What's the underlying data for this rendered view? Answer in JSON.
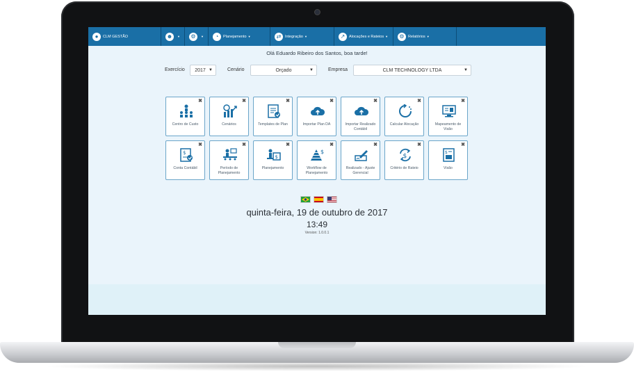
{
  "navbar": {
    "brand": "CLM GESTÃO",
    "menus": [
      "Planejamento",
      "Integração",
      "Alocações e Rateios",
      "Relatórios"
    ]
  },
  "greeting": "Olá Eduardo Ribeiro dos Santos, boa tarde!",
  "filters": {
    "exercicio_label": "Exercício",
    "exercicio_value": "2017",
    "cenario_label": "Cenário",
    "cenario_value": "Orçado",
    "empresa_label": "Empresa",
    "empresa_value": "CLM TECHNOLOGY LTDA"
  },
  "tiles": [
    {
      "label": "Centro de Custo",
      "icon": "org-chart-icon"
    },
    {
      "label": "Cenários",
      "icon": "money-chart-icon"
    },
    {
      "label": "Templates de Plan",
      "icon": "template-icon"
    },
    {
      "label": "Importar Plan DA",
      "icon": "cloud-upload-icon"
    },
    {
      "label": "Importar Realizado Contábil",
      "icon": "cloud-upload-icon"
    },
    {
      "label": "Calcular Alocação",
      "icon": "refresh-icon"
    },
    {
      "label": "Mapeamento de Visão",
      "icon": "monitor-icon"
    },
    {
      "label": "Conta Contábil",
      "icon": "document-money-icon"
    },
    {
      "label": "Período de Planejamento",
      "icon": "meeting-icon"
    },
    {
      "label": "Planejamento",
      "icon": "desk-icon"
    },
    {
      "label": "Workflow de Planejamento",
      "icon": "pyramid-icon"
    },
    {
      "label": "Realizado - Ajuste Gerencial",
      "icon": "signature-icon"
    },
    {
      "label": "Critério de Rateio",
      "icon": "currency-cycle-icon"
    },
    {
      "label": "Visão",
      "icon": "report-icon"
    }
  ],
  "flags": [
    "brazil-flag",
    "spain-flag",
    "usa-flag"
  ],
  "date": "quinta-feira, 19 de outubro de 2017",
  "time": "13:49",
  "version": "Version: 1.0.0.1",
  "colors": {
    "nav": "#1a6fa6",
    "screen_bg": "#eaf4fb",
    "tile_border": "#6aa5c9",
    "icon": "#1a6fa6"
  }
}
